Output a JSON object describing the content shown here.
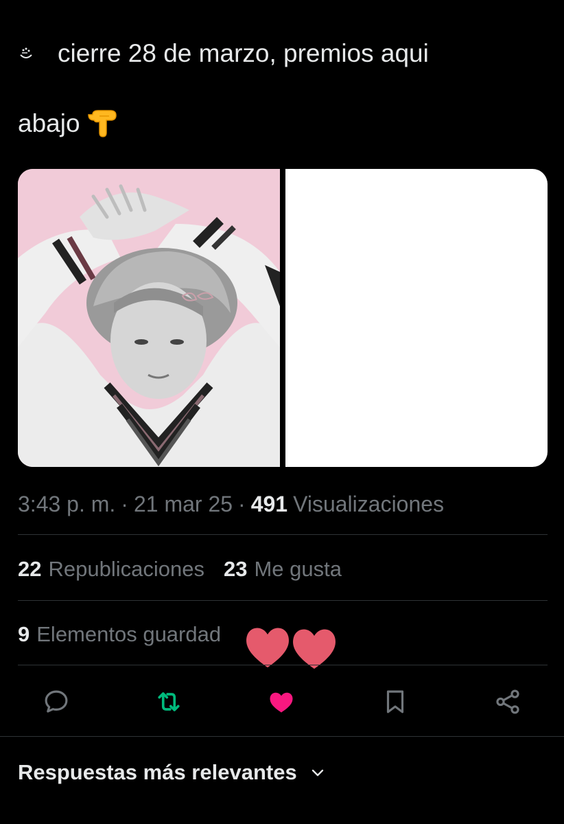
{
  "tweet": {
    "line1": "cierre 28 de marzo, premios aqui",
    "line2": "abajo",
    "leading_icon": "small-swirl-icon",
    "trailing_emoji": "pointing-down-hand-emoji"
  },
  "media": {
    "left_image": "photo-pink-background-person",
    "right_image": "blank-white-image",
    "left_bg_color": "#f1cbd8"
  },
  "meta": {
    "time": "3:43 p. m.",
    "date": "21 mar 25",
    "separator": "·",
    "views_count": "491",
    "views_label": "Visualizaciones"
  },
  "stats": {
    "reposts_count": "22",
    "reposts_label": "Republicaciones",
    "likes_count": "23",
    "likes_label": "Me gusta",
    "bookmarks_count": "9",
    "bookmarks_label": "Elementos guardad"
  },
  "actions": {
    "reply_icon": "reply-icon",
    "repost_icon": "repost-icon",
    "like_icon": "heart-icon",
    "bookmark_icon": "bookmark-icon",
    "share_icon": "share-icon",
    "repost_color": "#00ba7c",
    "like_color": "#f91880"
  },
  "replies": {
    "sort_label": "Respuestas más relevantes"
  },
  "colors": {
    "background": "#000000",
    "text_primary": "#e7e9ea",
    "text_secondary": "#71767b",
    "divider": "#2f3336"
  }
}
